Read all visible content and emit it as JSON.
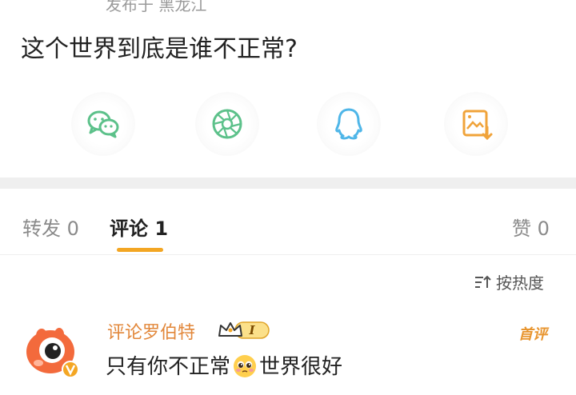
{
  "post": {
    "location_line": "发布于 黑龙江",
    "text": "这个世界到底是谁不正常?"
  },
  "share": {
    "items": [
      {
        "icon": "wechat-icon",
        "color": "#5cc18a"
      },
      {
        "icon": "moments-icon",
        "color": "#5cc18a"
      },
      {
        "icon": "qq-icon",
        "color": "#4fb6e8"
      },
      {
        "icon": "save-image-icon",
        "color": "#f0a33a"
      }
    ]
  },
  "tabs": {
    "repost": "转发 0",
    "comments": "评论 1",
    "likes": "赞 0",
    "accent": "#f3a623"
  },
  "sort": {
    "label": "按热度"
  },
  "comment": {
    "username": "评论罗伯特",
    "badge": "I",
    "first_tag": "首评",
    "text_before": "只有你不正常",
    "emoji": "pleading-face-emoji",
    "text_after": "世界很好"
  }
}
